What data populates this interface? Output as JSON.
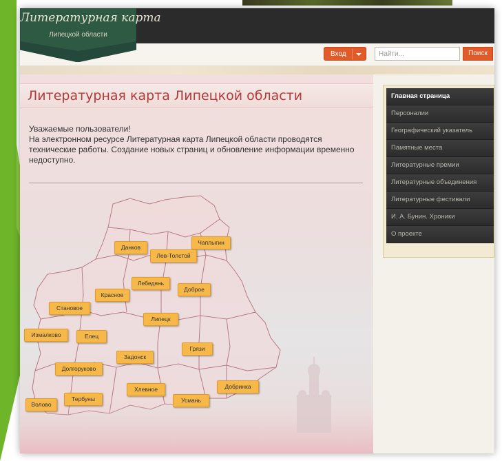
{
  "logo": {
    "title": "Литературная карта",
    "subtitle": "Липецкой области"
  },
  "toolbar": {
    "login_label": "Вход",
    "search_placeholder": "Найти...",
    "search_button": "Поиск"
  },
  "main": {
    "title": "Литературная карта Липецкой области",
    "notice_heading": "Уважаемые пользователи!",
    "notice_text": "На электронном ресурсе Литературная карта Липецкой области проводятся технические работы. Создание новых страниц и обновление информации временно недоступно."
  },
  "map": {
    "towns": {
      "dankov": "Данков",
      "chaplygin": "Чаплыгин",
      "lev_tolstoy": "Лев-Толстой",
      "lebedyan": "Лебедянь",
      "dobroe": "Доброе",
      "krasnoe": "Красное",
      "stanovoe": "Становое",
      "lipetsk": "Липецк",
      "izmalkovo": "Измалково",
      "elets": "Елец",
      "gryazi": "Грязи",
      "zadonsk": "Задонск",
      "dolgorukovo": "Долгоруково",
      "dobrinka": "Добринка",
      "khlevnoe": "Хлевное",
      "terbuny": "Тербуны",
      "volovo": "Волово",
      "usman": "Усмань"
    }
  },
  "sidebar": {
    "items": [
      "Главная страница",
      "Персоналии",
      "Географический указатель",
      "Памятные места",
      "Литературные премии",
      "Литературные объединения",
      "Литературные фестивали",
      "И. А. Бунин. Хроники",
      "О проекте"
    ]
  },
  "colors": {
    "accent_orange": "#e05a2a",
    "title_red": "#b33a3a",
    "town_label": "#f7b84a",
    "menu_dark": "#2c2c2c",
    "green_arrow": "#7bc02f"
  }
}
